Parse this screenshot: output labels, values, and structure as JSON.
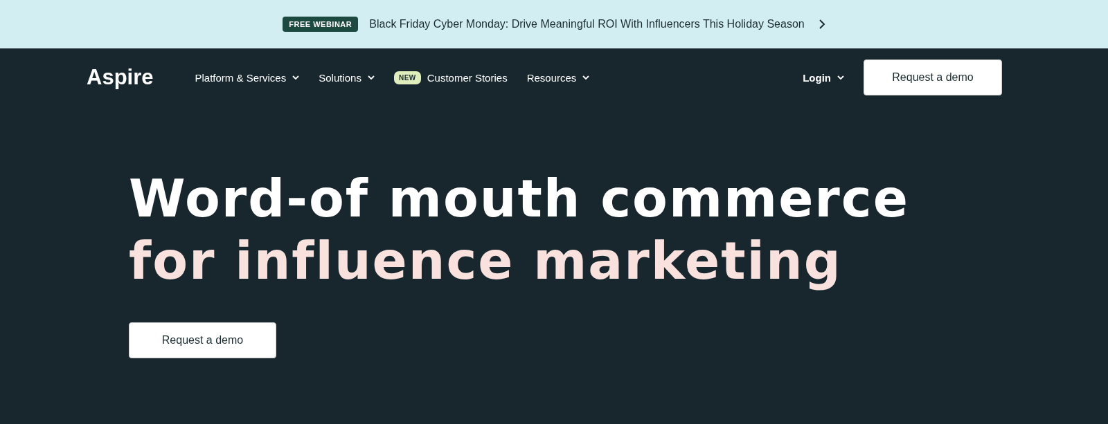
{
  "announcement": {
    "badge": "FREE WEBINAR",
    "text": "Black Friday Cyber Monday: Drive Meaningful ROI With Influencers This Holiday Season"
  },
  "nav": {
    "logo": "Aspire",
    "items": [
      {
        "label": "Platform & Services",
        "dropdown": true
      },
      {
        "label": "Solutions",
        "dropdown": true
      },
      {
        "label": "Customer Stories",
        "dropdown": false,
        "badge": "NEW"
      },
      {
        "label": "Resources",
        "dropdown": true
      }
    ],
    "login": {
      "label": "Login",
      "dropdown": true
    },
    "cta": "Request a demo"
  },
  "hero": {
    "headline_line_1": "Word-of mouth commerce",
    "headline_line_2": "for influence marketing",
    "cta": "Request a demo"
  }
}
